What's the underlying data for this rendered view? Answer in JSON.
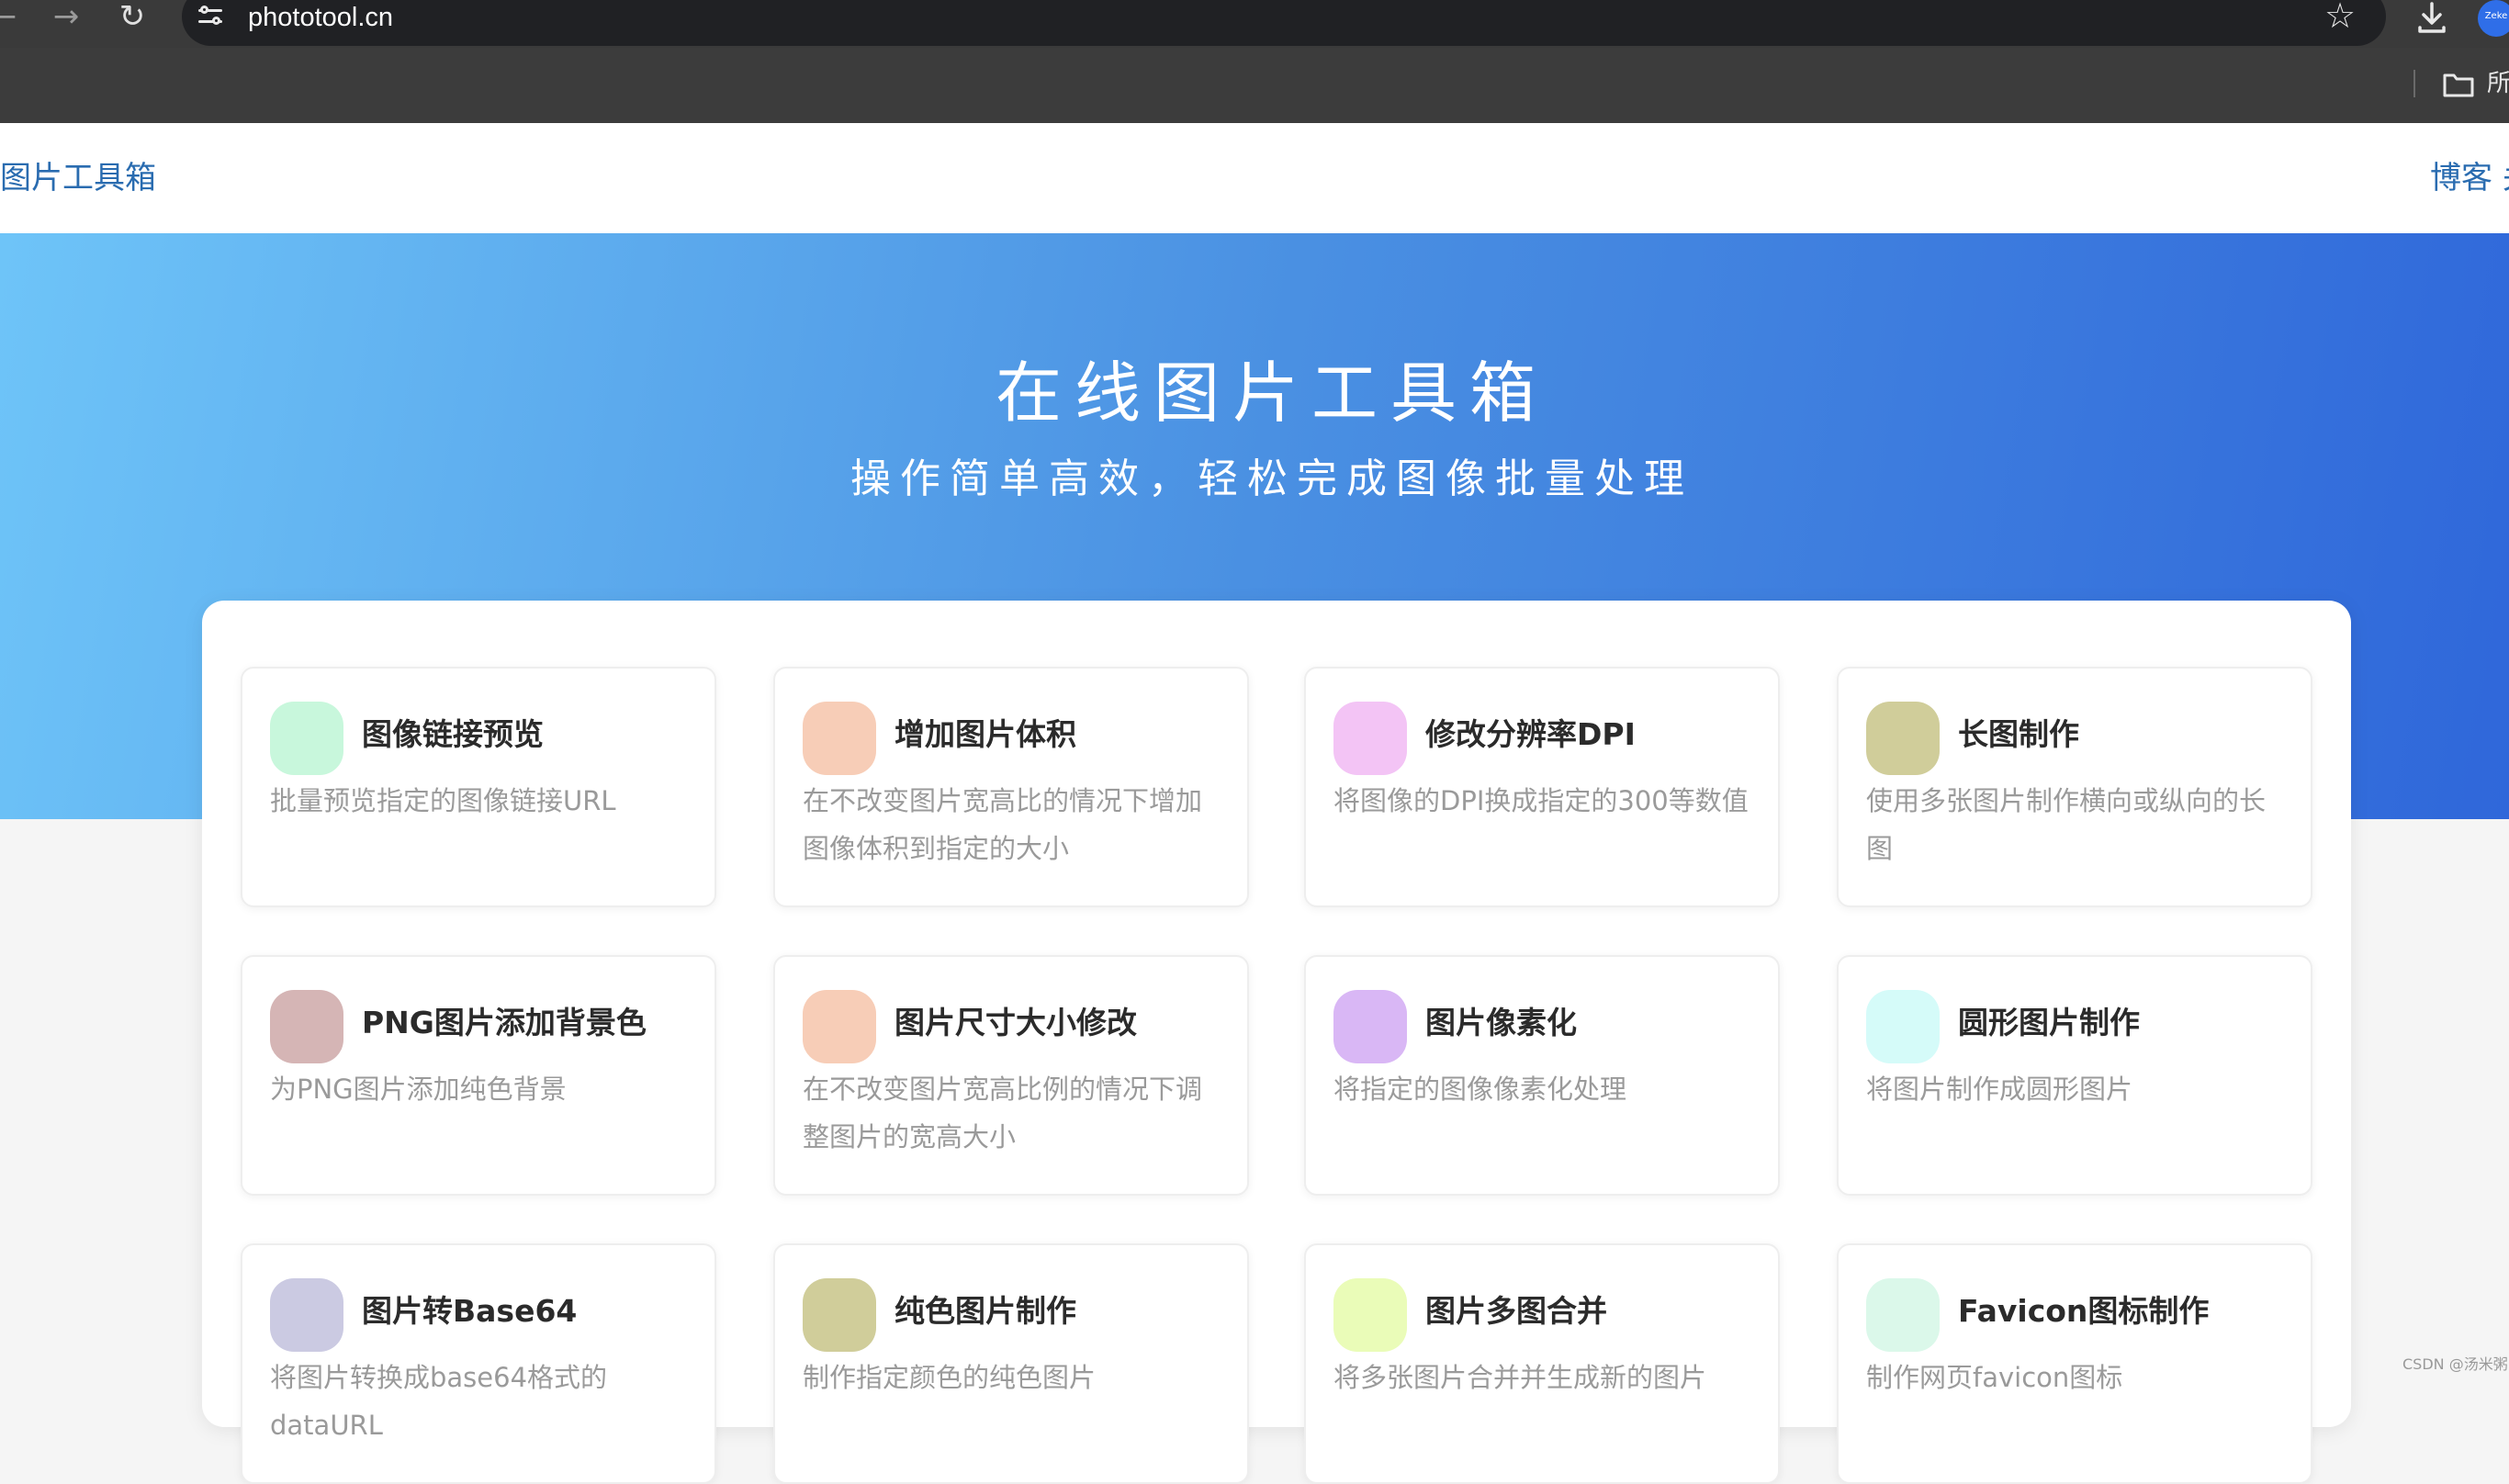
{
  "browser": {
    "url": "phototool.cn",
    "bookmark_label": "所",
    "profile_label": "Zeke"
  },
  "header": {
    "logo": "图片工具箱",
    "nav": "博客 关"
  },
  "hero": {
    "title": "在线图片工具箱",
    "subtitle": "操作简单高效，轻松完成图像批量处理"
  },
  "tools": [
    {
      "title": "图像链接预览",
      "desc": "批量预览指定的图像链接URL",
      "color": "#c8f7dc"
    },
    {
      "title": "增加图片体积",
      "desc": "在不改变图片宽高比的情况下增加图像体积到指定的大小",
      "color": "#f7cdb7"
    },
    {
      "title": "修改分辨率DPI",
      "desc": "将图像的DPI换成指定的300等数值",
      "color": "#f3c4f5"
    },
    {
      "title": "长图制作",
      "desc": "使用多张图片制作横向或纵向的长图",
      "color": "#d0cd9a"
    },
    {
      "title": "PNG图片添加背景色",
      "desc": "为PNG图片添加纯色背景",
      "color": "#d5b5b5"
    },
    {
      "title": "图片尺寸大小修改",
      "desc": "在不改变图片宽高比例的情况下调整图片的宽高大小",
      "color": "#f7cdb7"
    },
    {
      "title": "图片像素化",
      "desc": "将指定的图像像素化处理",
      "color": "#d9b7f5"
    },
    {
      "title": "圆形图片制作",
      "desc": "将图片制作成圆形图片",
      "color": "#d5fbf9"
    },
    {
      "title": "图片转Base64",
      "desc": "将图片转换成base64格式的dataURL",
      "color": "#cbcae2"
    },
    {
      "title": "纯色图片制作",
      "desc": "制作指定颜色的纯色图片",
      "color": "#d0cd9a"
    },
    {
      "title": "图片多图合并",
      "desc": "将多张图片合并并生成新的图片",
      "color": "#eafcb8"
    },
    {
      "title": "Favicon图标制作",
      "desc": "制作网页favicon图标",
      "color": "#dbf8ea"
    }
  ],
  "watermark": "CSDN @汤米粥"
}
